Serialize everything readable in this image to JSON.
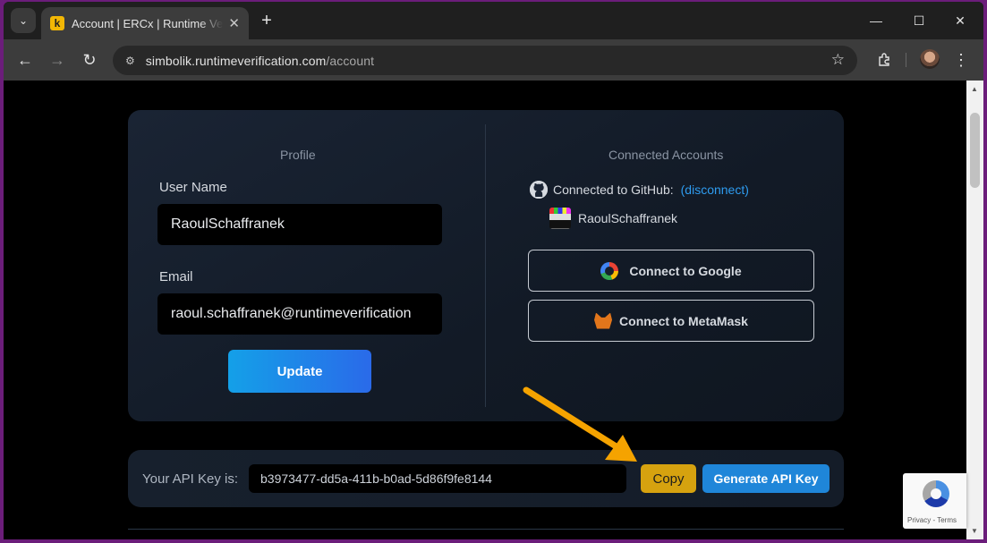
{
  "browser": {
    "tab_title": "Account | ERCx | Runtime Verification",
    "favicon_letter": "k",
    "url_main": "simbolik.runtimeverification.com",
    "url_path": "/account"
  },
  "profile": {
    "section_title": "Profile",
    "username_label": "User Name",
    "username_value": "RaoulSchaffranek",
    "email_label": "Email",
    "email_value": "raoul.schaffranek@runtimeverification",
    "update_label": "Update"
  },
  "connected": {
    "section_title": "Connected Accounts",
    "github_text": "Connected to GitHub:",
    "github_disconnect": "(disconnect)",
    "github_user": "RaoulSchaffranek",
    "google_label": "Connect to Google",
    "metamask_label": "Connect to MetaMask"
  },
  "api": {
    "label": "Your API Key is:",
    "key": "b3973477-dd5a-411b-b0ad-5d86f9fe8144",
    "copy_label": "Copy",
    "generate_label": "Generate API Key"
  },
  "recaptcha": {
    "privacy": "Privacy",
    "terms": "Terms"
  },
  "colors": {
    "arrow": "#f5a300",
    "accent_blue": "#1f86d9",
    "copy_gold": "#d6a20f"
  }
}
